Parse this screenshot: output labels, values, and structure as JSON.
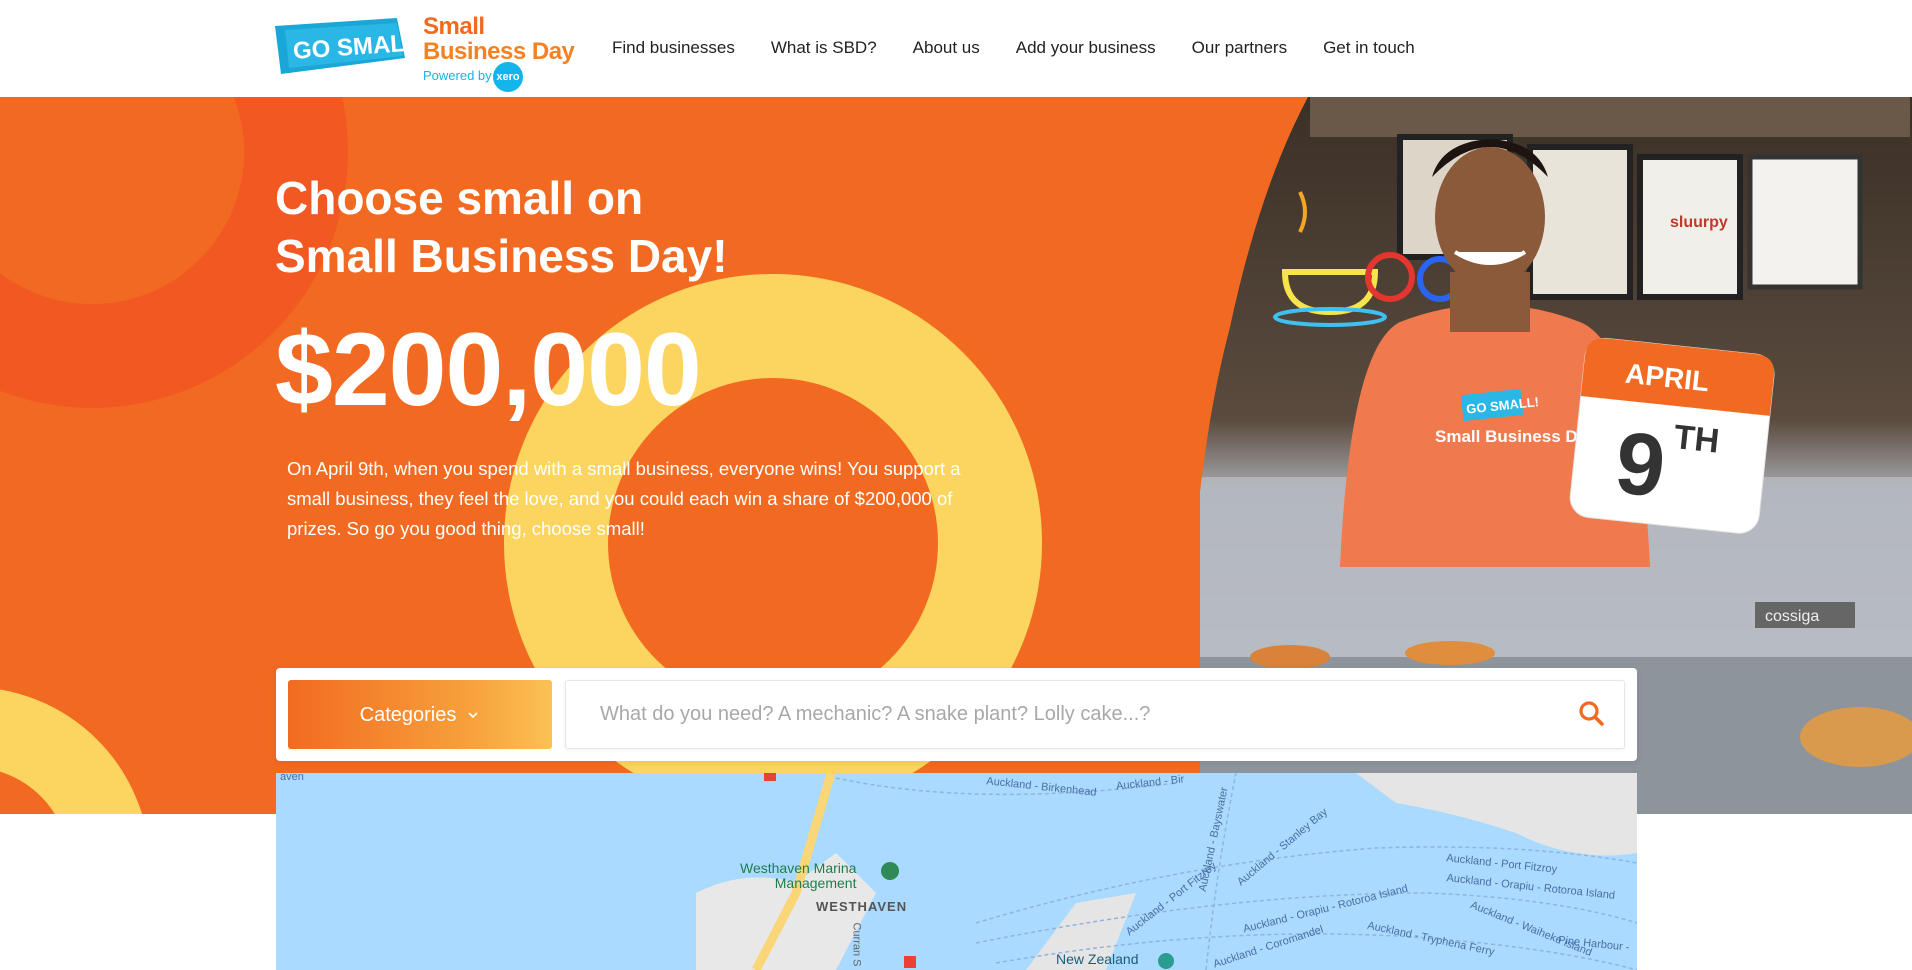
{
  "brand": {
    "logo_badge": "GO SMALL!",
    "name_line1": "Small",
    "name_line2": "Business Day",
    "powered_by": "Powered by",
    "partner_badge": "xero"
  },
  "nav": {
    "items": [
      {
        "label": "Find businesses"
      },
      {
        "label": "What is SBD?"
      },
      {
        "label": "About us"
      },
      {
        "label": "Add your business"
      },
      {
        "label": "Our partners"
      },
      {
        "label": "Get in touch"
      }
    ]
  },
  "hero": {
    "title_line1": "Choose small on",
    "title_line2": "Small Business Day!",
    "amount": "$200,000",
    "description": "On April 9th, when you spend with a small business, everyone wins! You support a small business, they feel the love, and you could each win a share of $200,000 of prizes. So go you good thing, choose small!",
    "calendar_month": "APRIL",
    "calendar_day": "9",
    "calendar_suffix": "TH",
    "shirt_badge": "GO SMALL!",
    "shirt_text": "Small Business Day",
    "sign_coffee": "Coffee",
    "sign_cossiga": "cossiga",
    "sign_slurpy": "sluurpy"
  },
  "search": {
    "categories_label": "Categories",
    "placeholder": "What do you need? A mechanic? A snake plant? Lolly cake...?"
  },
  "map": {
    "labels": {
      "westhaven_marina": "Westhaven Marina\nManagement",
      "westhaven": "WESTHAVEN",
      "auckland_birkenhead": "Auckland - Birkenhead",
      "auckland_bir": "Auckland - Bir",
      "auckland_bayswater": "Auckland - Bayswater",
      "auckland_stanley_bay": "Auckland - Stanley Bay",
      "auckland_port_fitzroy_1": "Auckland - Port Fitzroy",
      "auckland_port_fitzroy_2": "Auckland - Port Fitzroy",
      "auckland_orapiu_rotoroa_1": "Auckland - Orapiu - Rotoroa Island",
      "auckland_orapiu_rotoroa_2": "Auckland - Orapiu - Rotoroa Island",
      "auckland_coromandel": "Auckland - Coromandel",
      "auckland_tryphena": "Auckland - Tryphena Ferry",
      "auckland_waiheke": "Auckland - Waiheke Island",
      "pine_harbour": "Pine Harbour -",
      "new_zealand": "New Zealand",
      "curran": "Curran S",
      "haven": "aven"
    }
  },
  "colors": {
    "orange": "#f26a21",
    "deep_orange": "#f25822",
    "yellow": "#fbd560",
    "map_water": "#aadaff",
    "search_icon": "#f26a21"
  }
}
